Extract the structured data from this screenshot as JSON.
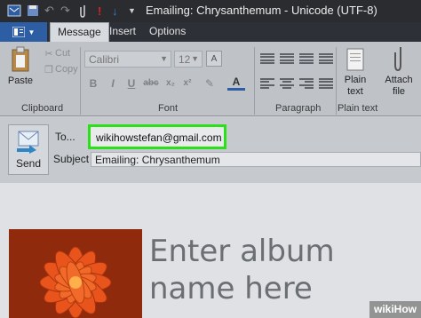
{
  "window": {
    "title": "Emailing: Chrysanthemum - Unicode (UTF-8)"
  },
  "tabs": [
    {
      "label": "Message",
      "active": true
    },
    {
      "label": "Insert",
      "active": false
    },
    {
      "label": "Options",
      "active": false
    }
  ],
  "ribbon": {
    "clipboard": {
      "paste": "Paste",
      "cut": "Cut",
      "copy": "Copy",
      "label": "Clipboard"
    },
    "font": {
      "family": "Calibri",
      "size": "12",
      "label": "Font"
    },
    "paragraph": {
      "label": "Paragraph"
    },
    "plain_text": {
      "button": "Plain\ntext",
      "label": "Plain text"
    },
    "attach": {
      "button": "Attach\nfile"
    }
  },
  "compose": {
    "send_label": "Send",
    "to_label": "To...",
    "to_value": "wikihowstefan@gmail.com",
    "subject_label": "Subject",
    "subject_value": "Emailing: Chrysanthemum"
  },
  "body": {
    "album_line1": "Enter album",
    "album_line2": "name here"
  },
  "watermark": "wikiHow",
  "colors": {
    "highlight": "#29e019",
    "file_button": "#2d5ea3",
    "accent_blue": "#3a7fd0"
  }
}
